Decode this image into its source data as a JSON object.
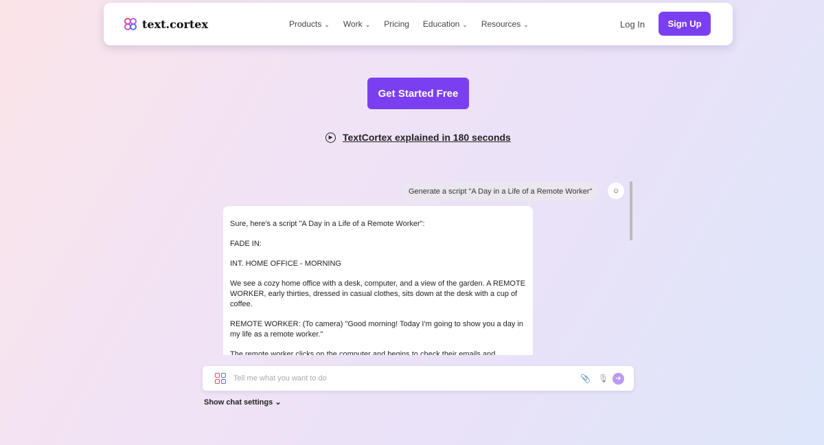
{
  "nav": {
    "logo": "text.cortex",
    "items": [
      {
        "label": "Products",
        "dropdown": true
      },
      {
        "label": "Work",
        "dropdown": true
      },
      {
        "label": "Pricing",
        "dropdown": false
      },
      {
        "label": "Education",
        "dropdown": true
      },
      {
        "label": "Resources",
        "dropdown": true
      }
    ],
    "login": "Log In",
    "signup": "Sign Up"
  },
  "hero": {
    "cta": "Get Started Free",
    "video_link": "TextCortex explained in 180 seconds"
  },
  "chat": {
    "user_message": "Generate a script \"A Day in a Life of a Remote Worker\"",
    "reply": [
      "Sure, here's a script \"A Day in a Life of a Remote Worker\":",
      "FADE IN:",
      "INT. HOME OFFICE - MORNING",
      "We see a cozy home office with a desk, computer, and a view of the garden. A REMOTE WORKER, early thirties, dressed in casual clothes, sits down at the desk with a cup of coffee.",
      "REMOTE WORKER: (To camera) \"Good morning! Today I'm going to show you a day in my life as a remote worker.\"",
      "The remote worker clicks on the computer and begins to check their emails and"
    ],
    "input_placeholder": "Tell me what you want to do",
    "settings": "Show chat settings"
  },
  "colors": {
    "accent": "#7b3ff2"
  }
}
